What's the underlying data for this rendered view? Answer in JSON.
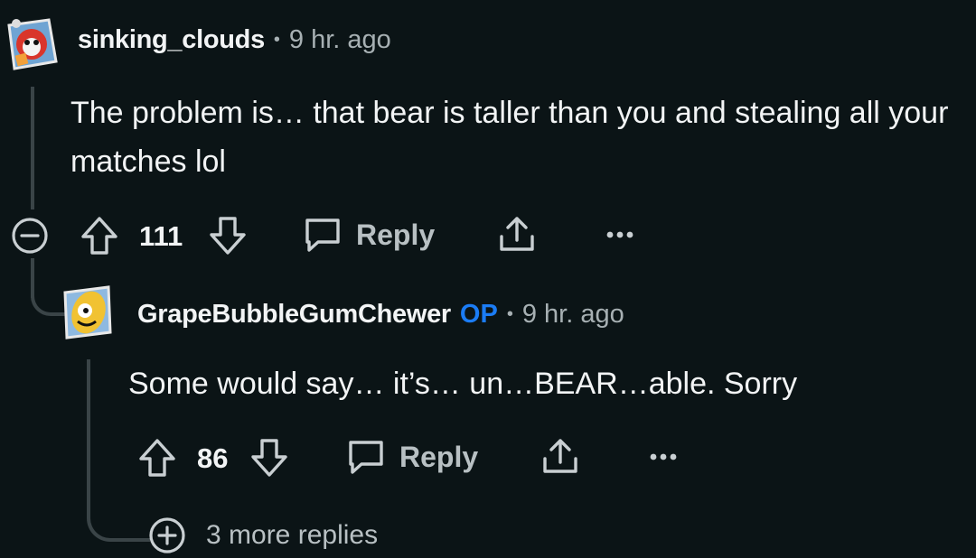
{
  "comment": {
    "author": "sinking_clouds",
    "separator": "•",
    "time": "9 hr. ago",
    "body": "The problem is… that bear is taller than you and stealing all your matches lol",
    "score": "111",
    "reply_label": "Reply"
  },
  "reply": {
    "author": "GrapeBubbleGumChewer",
    "op_badge": "OP",
    "separator": "•",
    "time": "9 hr. ago",
    "body": "Some would say… it’s… un…BEAR…able. Sorry",
    "score": "86",
    "reply_label": "Reply",
    "more_replies": "3 more replies"
  },
  "colors": {
    "background": "#0b1416",
    "op": "#1b7cf5",
    "thread_line": "#3a4447"
  },
  "icons": [
    "collapse-icon",
    "upvote-icon",
    "downvote-icon",
    "comment-icon",
    "share-icon",
    "more-icon",
    "expand-icon"
  ]
}
